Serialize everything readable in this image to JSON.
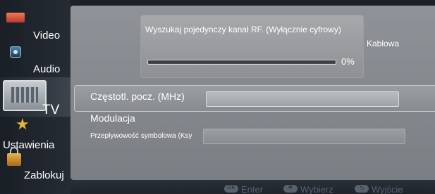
{
  "sidebar": {
    "items": [
      {
        "label": "Video",
        "icon": "video-icon"
      },
      {
        "label": "Audio",
        "icon": "audio-icon"
      },
      {
        "label": "TV",
        "icon": "tv-icon",
        "selected": true
      },
      {
        "label": "Ustawienia",
        "icon": "star-icon"
      },
      {
        "label": "Zablokuj",
        "icon": "lock-icon"
      }
    ]
  },
  "search": {
    "title": "Wyszukaj pojedynczy kanał RF. (Wyłącznie cyfrowy)",
    "progress_percent": "0%",
    "progress_value": 0
  },
  "mode": {
    "value": "Kablowa"
  },
  "fields": {
    "start_freq_label": "Częstotl. pocz. (MHz)",
    "start_freq_value": "",
    "modulation_label": "Modulacja",
    "symbol_rate_label": "Przepływowość symbolowa (Ksy",
    "symbol_rate_value": ""
  },
  "footer": {
    "enter": "Enter",
    "select": "Wybierz",
    "exit": "Wyjście"
  },
  "colors": {
    "panel": "#878b90",
    "sidebar": "#1d2229",
    "accent_star": "#e7b43a",
    "hint_text": "#59616b"
  }
}
